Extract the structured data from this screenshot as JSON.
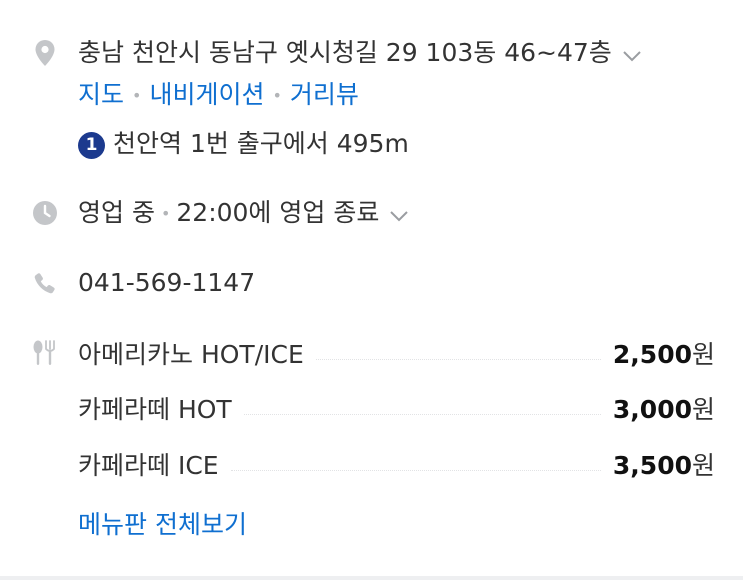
{
  "address": {
    "text": "충남 천안시 동남구 옛시청길 29 103동 46~47층",
    "links": [
      "지도",
      "내비게이션",
      "거리뷰"
    ],
    "station_number": "1",
    "station_text": "천안역 1번 출구에서 495m"
  },
  "hours": {
    "status": "영업 중",
    "detail": "22:00에 영업 종료"
  },
  "phone": "041-569-1147",
  "menu": {
    "items": [
      {
        "name": "아메리카노 HOT/ICE",
        "price": "2,500",
        "unit": "원"
      },
      {
        "name": "카페라떼 HOT",
        "price": "3,000",
        "unit": "원"
      },
      {
        "name": "카페라떼 ICE",
        "price": "3,500",
        "unit": "원"
      }
    ],
    "more_label": "메뉴판 전체보기"
  },
  "colors": {
    "link": "#0f6fd0",
    "icon": "#c4c6c9",
    "station_badge": "#1c3a8e"
  },
  "icons": [
    "location-pin-icon",
    "clock-icon",
    "phone-icon",
    "utensils-icon",
    "chevron-down-icon"
  ]
}
